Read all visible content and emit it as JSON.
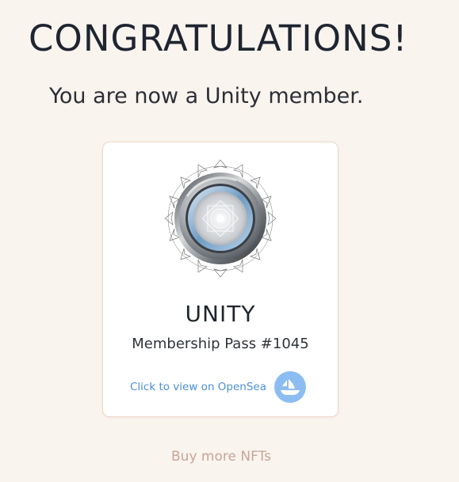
{
  "header": {
    "title": "CONGRATULATIONS!",
    "subtitle": "You are now a Unity member."
  },
  "card": {
    "badge_icon": "unity-membership-badge-icon",
    "name": "UNITY",
    "pass": "Membership Pass #1045",
    "opensea_label": "Click to view on OpenSea",
    "opensea_icon": "opensea-ship-icon"
  },
  "footer": {
    "buy_more_label": "Buy more NFTs"
  },
  "colors": {
    "background": "#faf4ef",
    "link_blue": "#4a8fd8",
    "opensea_badge": "#8cbdf2",
    "buy_more": "#c8a597"
  }
}
